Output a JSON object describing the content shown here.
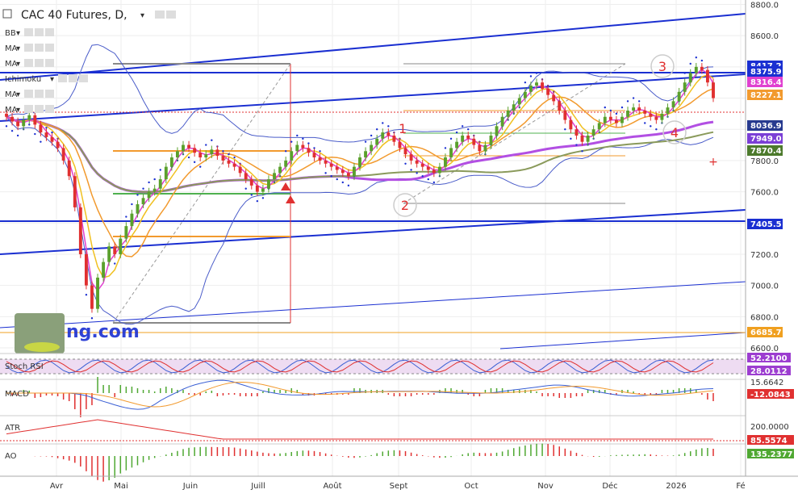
{
  "chart_data": {
    "type": "line",
    "title": "CAC 40 Futures, D,",
    "colors": {
      "up": "#5aa02c",
      "down": "#e03030",
      "grid": "#eeeeee",
      "blue_line": "#1a2fd1",
      "bb": "#4a5cc9",
      "ma_yellow": "#f0c020",
      "ma_orange": "#f29a2e",
      "ma_pink": "#e040d0",
      "ma200": "#8a9a5b",
      "ma_purple": "#b24fe3"
    },
    "indicators": [
      "BB",
      "MA",
      "MA",
      "Ichimoku",
      "MA",
      "MA"
    ],
    "y_axis": {
      "ticks": [
        8800,
        8600,
        8400,
        8200,
        8000,
        7800,
        7600,
        7400,
        7200,
        7000,
        6800,
        6600
      ],
      "tick_labels": [
        "8800.0",
        "8600.0",
        "",
        "",
        "",
        "7800.0",
        "7600.0",
        "",
        "7200.0",
        "7000.0",
        "6800.0",
        "6600.0"
      ],
      "range": [
        6600,
        8880
      ]
    },
    "x_axis": {
      "labels": [
        "Avr",
        "Mai",
        "Juin",
        "Juill",
        "Août",
        "Sept",
        "Oct",
        "Nov",
        "Déc",
        "2026",
        "Fé"
      ]
    },
    "price_tags": [
      {
        "value": "8417.2",
        "bg": "#1a2fd1"
      },
      {
        "value": "8375.9",
        "bg": "#1a2fd1"
      },
      {
        "value": "8316.4",
        "bg": "#e040d0"
      },
      {
        "value": "8227.1",
        "bg": "#f29a2e"
      },
      {
        "value": "8036.9",
        "bg": "#273a8f"
      },
      {
        "value": "7949.0",
        "bg": "#7b3fd6"
      },
      {
        "value": "7870.4",
        "bg": "#4c7a2c"
      },
      {
        "value": "7405.5",
        "bg": "#1a2fd1"
      },
      {
        "value": "6685.7",
        "bg": "#f0a020"
      }
    ],
    "annotations": [
      "1",
      "2",
      "3",
      "4"
    ],
    "watermark": "ng.com",
    "closes": [
      8080,
      8050,
      8020,
      8060,
      8090,
      8030,
      7980,
      7950,
      7920,
      7880,
      7800,
      7700,
      7500,
      7200,
      7000,
      6850,
      7050,
      7150,
      7250,
      7200,
      7300,
      7380,
      7460,
      7520,
      7560,
      7600,
      7620,
      7680,
      7760,
      7820,
      7860,
      7900,
      7880,
      7850,
      7820,
      7840,
      7870,
      7830,
      7800,
      7780,
      7760,
      7720,
      7680,
      7640,
      7600,
      7620,
      7680,
      7720,
      7760,
      7800,
      7860,
      7900,
      7880,
      7850,
      7820,
      7800,
      7780,
      7760,
      7740,
      7720,
      7700,
      7760,
      7820,
      7860,
      7900,
      7940,
      7980,
      7960,
      7920,
      7880,
      7840,
      7800,
      7780,
      7760,
      7740,
      7720,
      7760,
      7820,
      7880,
      7920,
      7960,
      7940,
      7900,
      7860,
      7900,
      7960,
      8020,
      8080,
      8120,
      8160,
      8200,
      8240,
      8280,
      8300,
      8260,
      8220,
      8180,
      8120,
      8060,
      8000,
      7960,
      7920,
      7960,
      8000,
      8040,
      8080,
      8060,
      8040,
      8080,
      8120,
      8140,
      8120,
      8100,
      8080,
      8060,
      8100,
      8140,
      8180,
      8240,
      8300,
      8360,
      8400,
      8380,
      8300,
      8200
    ],
    "stoch_rsi": {
      "values": [
        "52.2100",
        "28.0112"
      ],
      "levels": [
        80,
        20
      ]
    },
    "macd": {
      "values": [
        "15.6642",
        "-12.0843"
      ]
    },
    "atr": {
      "values": [
        "200.0000",
        "85.5574"
      ]
    },
    "ao": {
      "values": [
        "135.2377"
      ]
    }
  }
}
